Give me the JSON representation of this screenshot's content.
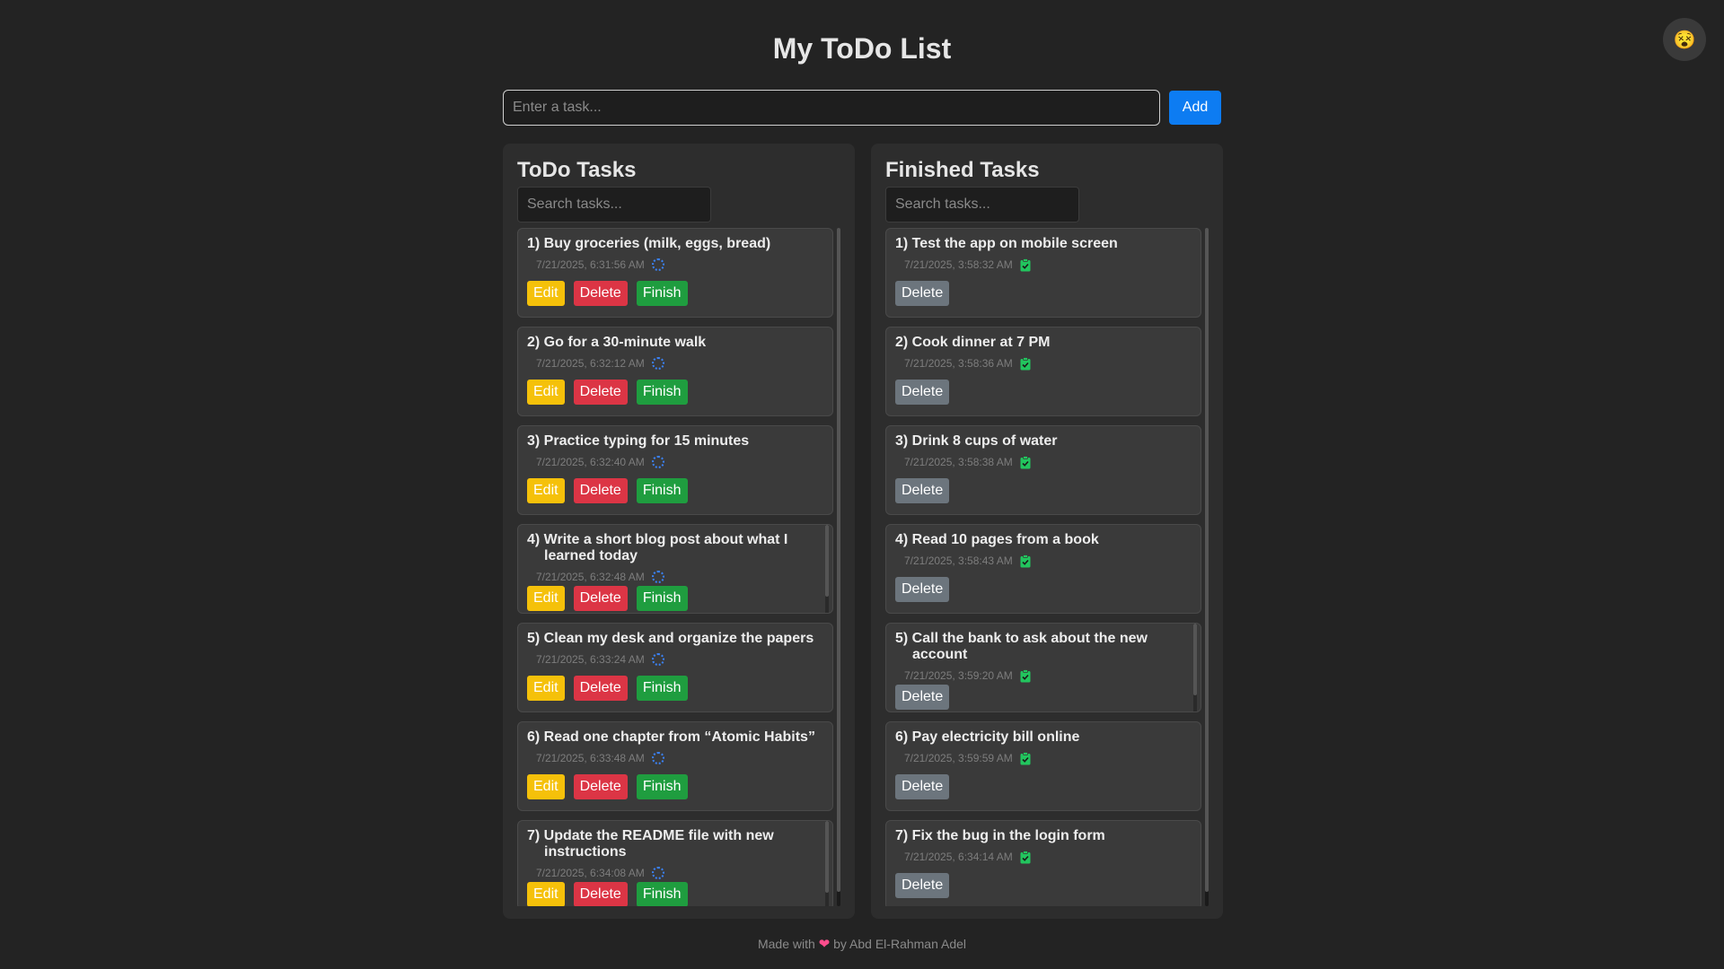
{
  "app": {
    "title": "My ToDo List"
  },
  "theme_toggle": {
    "icon": "emoji-face-icon",
    "glyph": "😵"
  },
  "add_task": {
    "placeholder": "Enter a task...",
    "add_label": "Add"
  },
  "todo_panel": {
    "heading": "ToDo Tasks",
    "search_placeholder": "Search tasks...",
    "buttons": {
      "edit": "Edit",
      "delete": "Delete",
      "finish": "Finish"
    },
    "tasks": [
      {
        "title": "1) Buy groceries (milk, eggs, bread)",
        "timestamp": "7/21/2025, 6:31:56 AM"
      },
      {
        "title": "2) Go for a 30-minute walk",
        "timestamp": "7/21/2025, 6:32:12 AM"
      },
      {
        "title": "3) Practice typing for 15 minutes",
        "timestamp": "7/21/2025, 6:32:40 AM"
      },
      {
        "title": "4) Write a short blog post about what I learned today",
        "timestamp": "7/21/2025, 6:32:48 AM"
      },
      {
        "title": "5) Clean my desk and organize the papers",
        "timestamp": "7/21/2025, 6:33:24 AM"
      },
      {
        "title": "6) Read one chapter from “Atomic Habits”",
        "timestamp": "7/21/2025, 6:33:48 AM"
      },
      {
        "title": "7) Update the README file with new instructions",
        "timestamp": "7/21/2025, 6:34:08 AM"
      }
    ]
  },
  "finished_panel": {
    "heading": "Finished Tasks",
    "search_placeholder": "Search tasks...",
    "buttons": {
      "delete": "Delete"
    },
    "tasks": [
      {
        "title": "1) Test the app on mobile screen",
        "timestamp": "7/21/2025, 3:58:32 AM"
      },
      {
        "title": "2) Cook dinner at 7 PM",
        "timestamp": "7/21/2025, 3:58:36 AM"
      },
      {
        "title": "3) Drink 8 cups of water",
        "timestamp": "7/21/2025, 3:58:38 AM"
      },
      {
        "title": "4) Read 10 pages from a book",
        "timestamp": "7/21/2025, 3:58:43 AM"
      },
      {
        "title": "5) Call the bank to ask about the new account",
        "timestamp": "7/21/2025, 3:59:20 AM"
      },
      {
        "title": "6) Pay electricity bill online",
        "timestamp": "7/21/2025, 3:59:59 AM"
      },
      {
        "title": "7) Fix the bug in the login form",
        "timestamp": "7/21/2025, 6:34:14 AM"
      }
    ]
  },
  "footer": {
    "prefix": "Made with",
    "suffix": "by Abd El-Rahman Adel"
  },
  "colors": {
    "add": "#0d7cf2",
    "edit": "#f5c10a",
    "delete": "#dc3545",
    "finish": "#1f9d3f",
    "finished_delete": "#6c757d",
    "pending_icon": "#3b82f6",
    "done_icon": "#22c55e",
    "heart": "#ff4d8d"
  }
}
